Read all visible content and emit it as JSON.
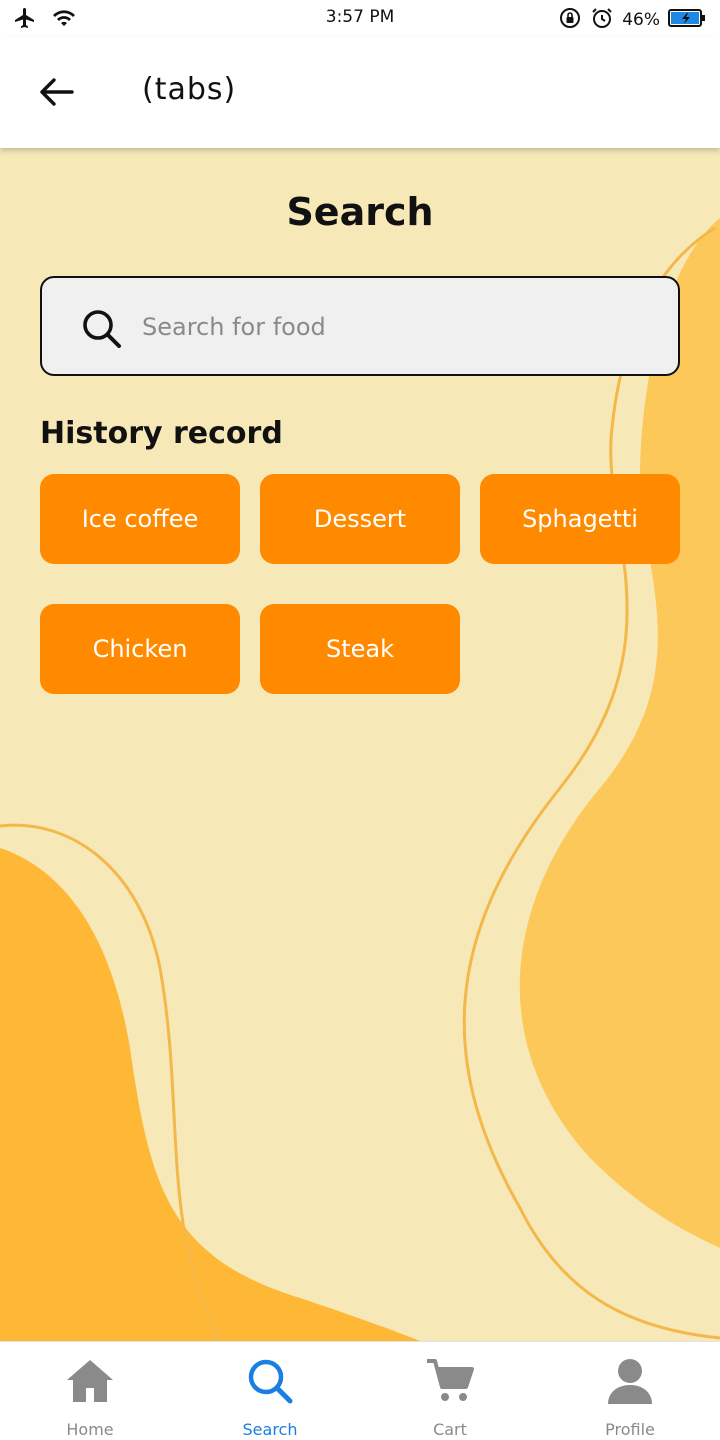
{
  "status_bar": {
    "time": "3:57 PM",
    "battery": "46%"
  },
  "app_bar": {
    "title": "(tabs)"
  },
  "page": {
    "title": "Search"
  },
  "search": {
    "placeholder": "Search for food",
    "value": ""
  },
  "history": {
    "label": "History record",
    "items": [
      "Ice coffee",
      "Dessert",
      "Sphagetti",
      "Chicken",
      "Steak"
    ]
  },
  "bottom_nav": {
    "items": [
      {
        "label": "Home",
        "icon": "home-icon"
      },
      {
        "label": "Search",
        "icon": "search-icon"
      },
      {
        "label": "Cart",
        "icon": "cart-icon"
      },
      {
        "label": "Profile",
        "icon": "profile-icon"
      }
    ],
    "active": "Search"
  },
  "colors": {
    "background": "#f7e8b8",
    "accent_orange": "#ff8a00",
    "blob": "#ffb836",
    "active_tab": "#1a7fe0",
    "inactive_tab": "#8a8a8a"
  }
}
